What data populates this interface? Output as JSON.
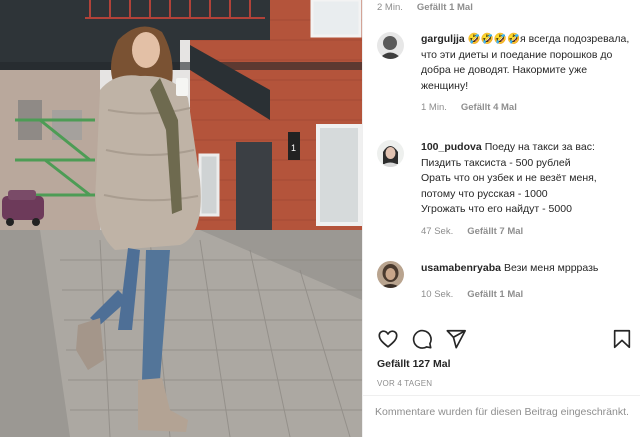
{
  "post": {
    "top_meta": {
      "time": "2 Min.",
      "likes": "Gefällt 1 Mal"
    },
    "comments": [
      {
        "user": "gargulјja",
        "text": "🤣🤣🤣🤣я всегда подозревала, что эти диеты и поедание порошков до добра не доводят. Накормите уже женщину!",
        "time": "1 Min.",
        "likes": "Gefällt 4 Mal"
      },
      {
        "user": "100_pudova",
        "text": "Поеду на такси за вас:\nПиздить таксиста - 500 рублей\nОрать что он узбек и не везёт меня, потому что русская - 1000\nУгрожать что его найдут - 5000",
        "time": "47 Sek.",
        "likes": "Gefällt 7 Mal"
      },
      {
        "user": "usamabenryaba",
        "text": "Вези меня мррразь",
        "time": "10 Sek.",
        "likes": "Gefällt 1 Mal"
      }
    ],
    "actions": {
      "like_icon": "heart-icon",
      "comment_icon": "comment-icon",
      "share_icon": "send-icon",
      "save_icon": "bookmark-icon"
    },
    "likes_count": "Gefällt 127 Mal",
    "posted": "VOR 4 TAGEN",
    "restricted_notice": "Kommentare wurden für diesen Beitrag eingeschränkt."
  }
}
